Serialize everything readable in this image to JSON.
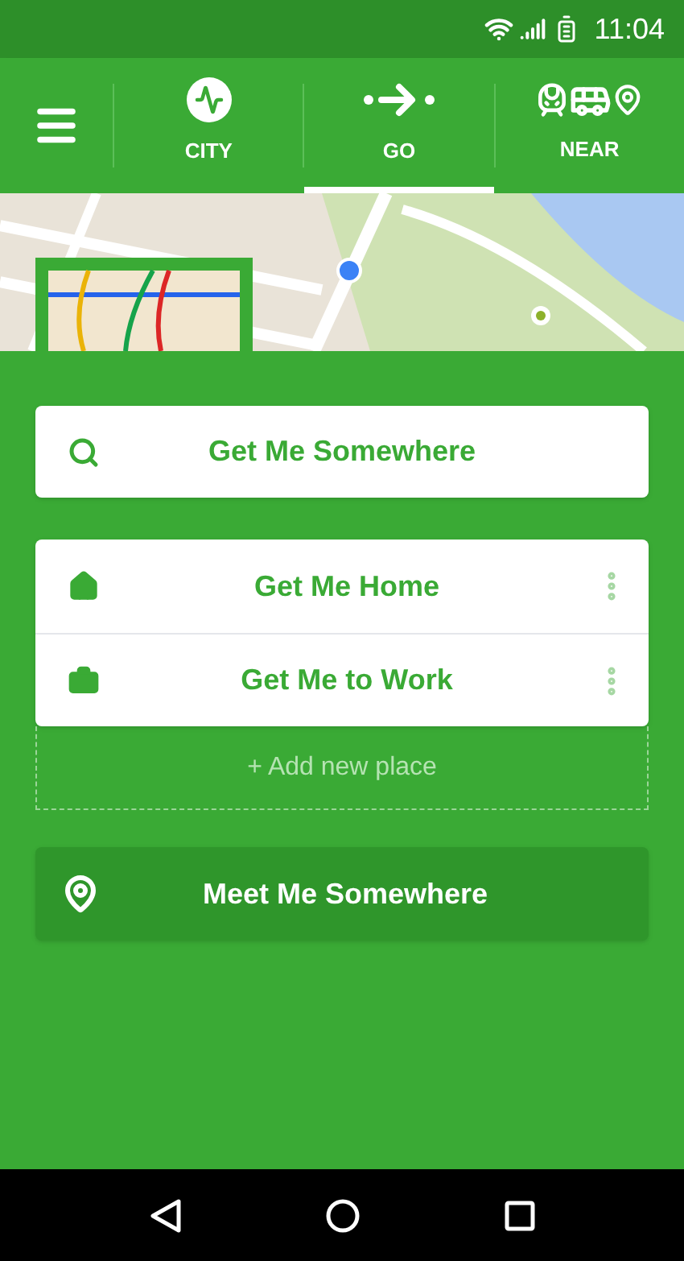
{
  "status_bar": {
    "time": "11:04"
  },
  "tabs": [
    {
      "label": "CITY",
      "kind": "city",
      "selected": false
    },
    {
      "label": "GO",
      "kind": "go",
      "selected": true
    },
    {
      "label": "NEAR",
      "kind": "near",
      "selected": false
    }
  ],
  "search_button": {
    "label": "Get Me Somewhere"
  },
  "places": [
    {
      "label": "Get Me Home",
      "kind": "home"
    },
    {
      "label": "Get Me to Work",
      "kind": "work"
    }
  ],
  "add_place": {
    "label": "+ Add new place"
  },
  "meet_button": {
    "label": "Meet Me Somewhere"
  }
}
